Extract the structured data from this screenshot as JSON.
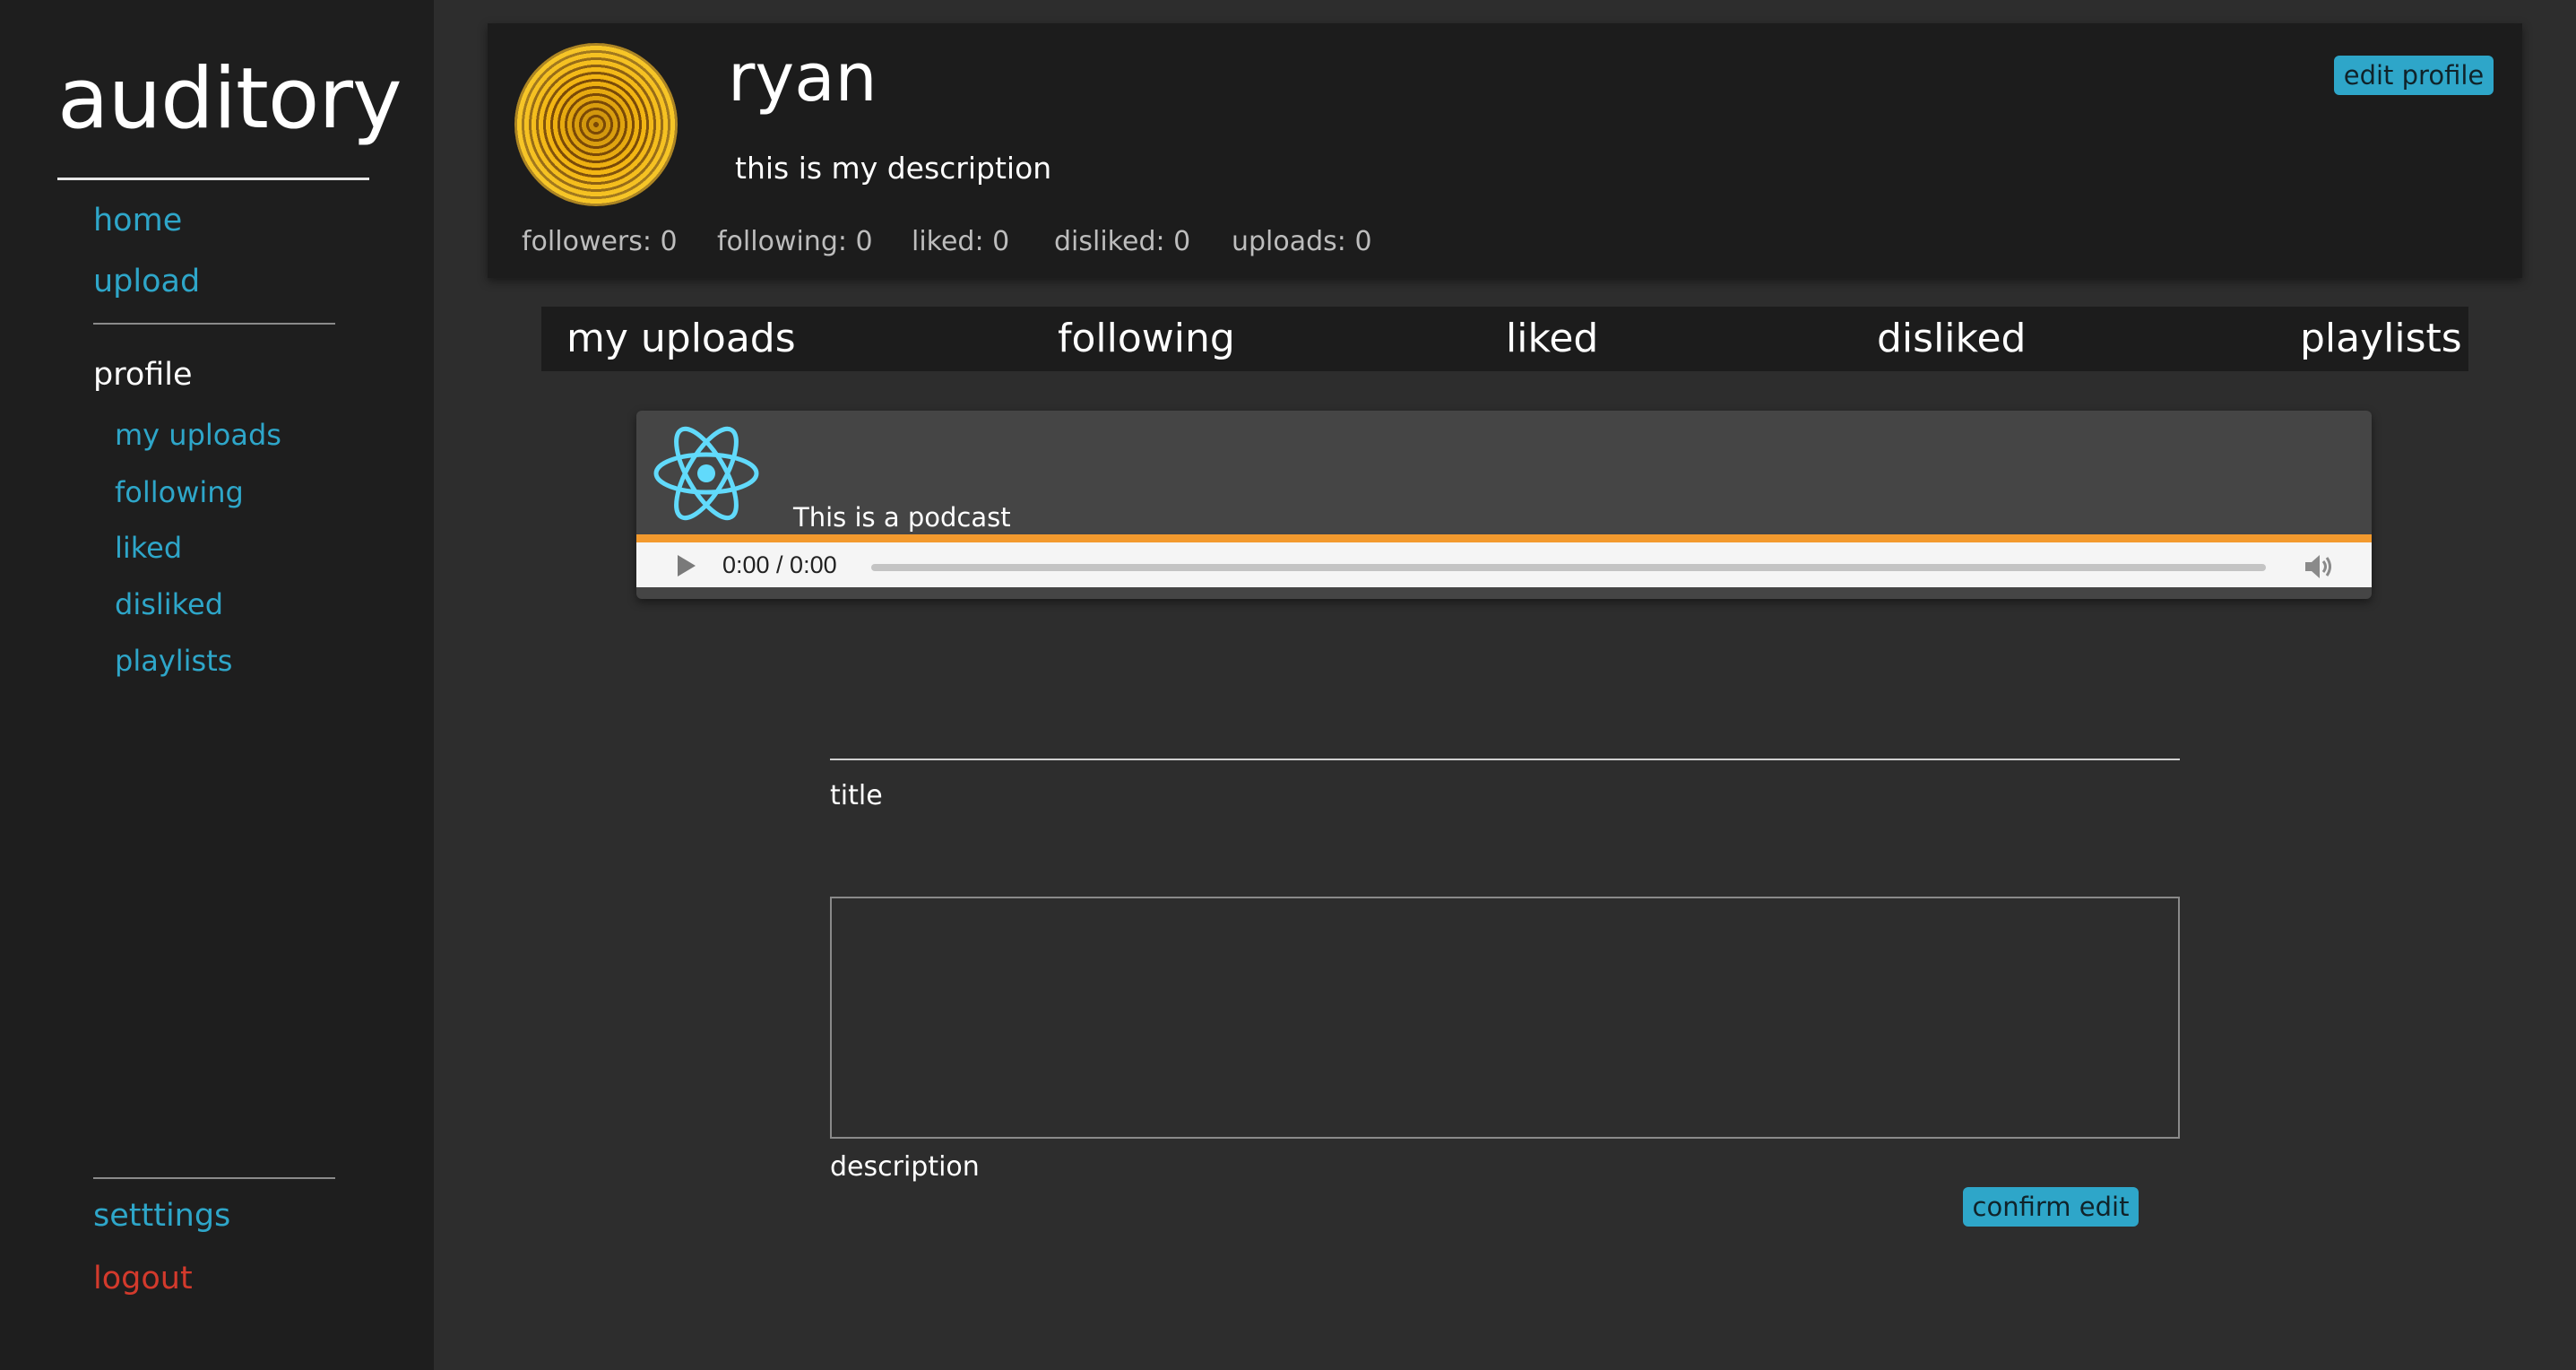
{
  "app": {
    "name": "auditory"
  },
  "sidebar": {
    "home": "home",
    "upload": "upload",
    "profile_header": "profile",
    "sub_items": [
      "my uploads",
      "following",
      "liked",
      "disliked",
      "playlists"
    ],
    "settings": "setttings",
    "logout": "logout"
  },
  "profile": {
    "username": "ryan",
    "description": "this is my description",
    "edit_button": "edit profile",
    "stats": {
      "followers": "followers: 0",
      "following": "following: 0",
      "liked": "liked: 0",
      "disliked": "disliked: 0",
      "uploads": "uploads: 0"
    }
  },
  "tabs": [
    "my uploads",
    "following",
    "liked",
    "disliked",
    "playlists"
  ],
  "upload_item": {
    "title": "This is a podcast",
    "player_time": "0:00 / 0:00",
    "accent_color": "#f39a2e",
    "icon": "react-icon"
  },
  "edit_form": {
    "title_label": "title",
    "description_label": "description",
    "confirm_button": "confirm edit"
  },
  "colors": {
    "link": "#2ea6c9",
    "logout": "#d33a2c",
    "button": "#2ea6c9"
  }
}
